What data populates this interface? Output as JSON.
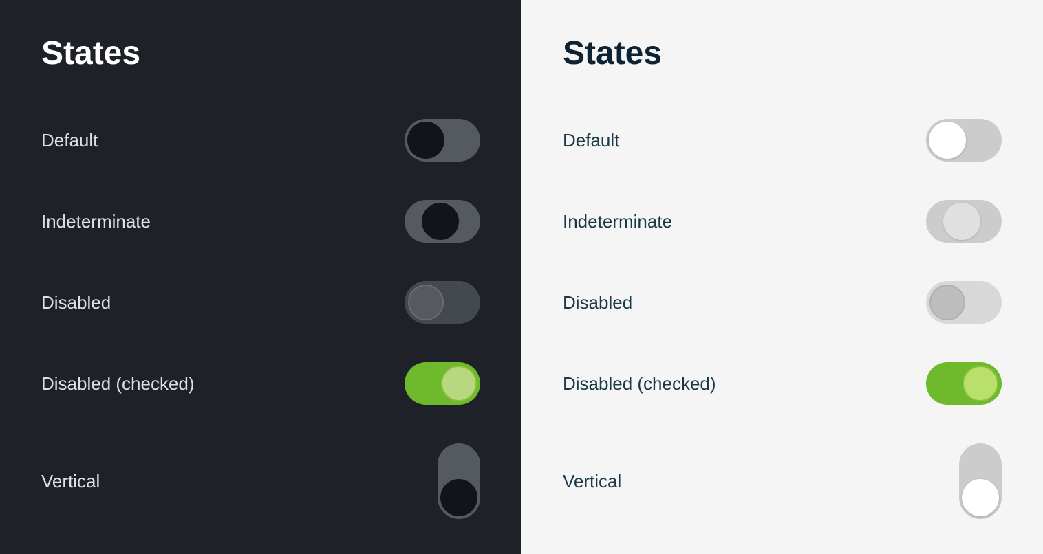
{
  "dark_panel": {
    "title": "States",
    "rows": [
      {
        "label": "Default"
      },
      {
        "label": "Indeterminate"
      },
      {
        "label": "Disabled"
      },
      {
        "label": "Disabled (checked)"
      },
      {
        "label": "Vertical"
      }
    ]
  },
  "light_panel": {
    "title": "States",
    "rows": [
      {
        "label": "Default"
      },
      {
        "label": "Indeterminate"
      },
      {
        "label": "Disabled"
      },
      {
        "label": "Disabled (checked)"
      },
      {
        "label": "Vertical"
      }
    ]
  }
}
